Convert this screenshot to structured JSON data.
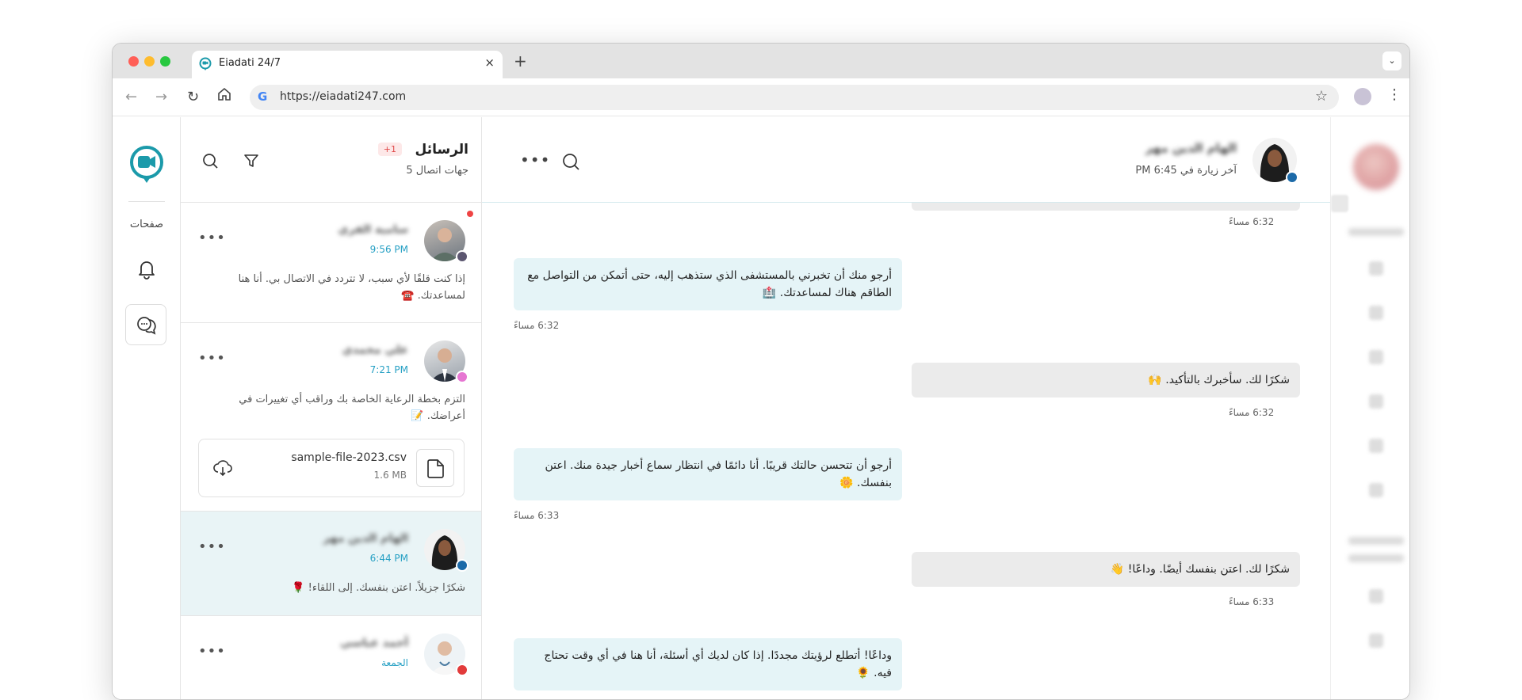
{
  "browser": {
    "tab_title": "Eiadati 24/7",
    "tab_close": "×",
    "new_tab": "+",
    "url": "https://eiadati247.com",
    "tab_menu": "⌄"
  },
  "nav": {
    "pages_label": "صفحات"
  },
  "conversations": {
    "title": "الرسائل",
    "badge": "+1",
    "subtitle": "5 جهات اتصال",
    "items": [
      {
        "name": "سامية الفري",
        "time": "9:56 PM",
        "preview": "إذا كنت قلقًا لأي سبب، لا تتردد في الاتصال بي. أنا هنا لمساعدتك. ☎️",
        "status_color": "#5b5670",
        "unread": true
      },
      {
        "name": "علي محمدي",
        "time": "7:21 PM",
        "preview": "التزم بخطة الرعاية الخاصة بك وراقب أي تغييرات في أعراضك. 📝",
        "status_color": "#e676d2",
        "file": {
          "name": "sample-file-2023.csv",
          "size": "1.6 MB"
        }
      },
      {
        "name": "الهام الدين مهر",
        "time": "6:44 PM",
        "preview": "شكرًا جزيلاً. اعتن بنفسك. إلى اللقاء! 🌹",
        "status_color": "#1c6aa8",
        "active": true
      },
      {
        "name": "أحمد عباسي",
        "time": "الجمعة",
        "preview": "",
        "status_color": "#e23b3b"
      }
    ]
  },
  "chat": {
    "contact_name": "الهام الدين مهر",
    "last_seen": "آخر زيارة في 6:45 PM",
    "messages": [
      {
        "dir": "in",
        "text": "أرجو منك أن تخبرني بالمستشفى الذي ستذهب إليه، حتى أتمكن من التواصل مع الطاقم هناك لمساعدتك. 🏥",
        "time": "6:32 مساءً"
      },
      {
        "dir": "out",
        "text": "شكرًا لك. سأخبرك بالتأكيد. 🙌",
        "time": "6:32 مساءً"
      },
      {
        "dir": "in",
        "text": "أرجو أن تتحسن حالتك قريبًا. أنا دائمًا في انتظار سماع أخبار جيدة منك. اعتن بنفسك. 🌼",
        "time": "6:33 مساءً"
      },
      {
        "dir": "out",
        "text": "شكرًا لك. اعتن بنفسك أيضًا. وداعًا! 👋",
        "time": "6:33 مساءً"
      },
      {
        "dir": "in",
        "text": "وداعًا! أتطلع لرؤيتك مجددًا. إذا كان لديك أي أسئلة، أنا هنا في أي وقت تحتاج فيه. 🌻",
        "time": ""
      }
    ],
    "top_time": "6:32 مساءً"
  },
  "colors": {
    "accent": "#26a0c4",
    "incoming_bubble": "#e5f4f7",
    "outgoing_bubble": "#ebebeb",
    "active_row": "#e9f4f6",
    "unread": "#ef4444"
  },
  "icons": [
    "logo-icon",
    "bell-icon",
    "chat-icon",
    "filter-icon",
    "search-icon",
    "more-icon",
    "file-icon",
    "cloud-download-icon",
    "star-icon",
    "reload-icon",
    "home-icon",
    "back-icon",
    "forward-icon"
  ]
}
